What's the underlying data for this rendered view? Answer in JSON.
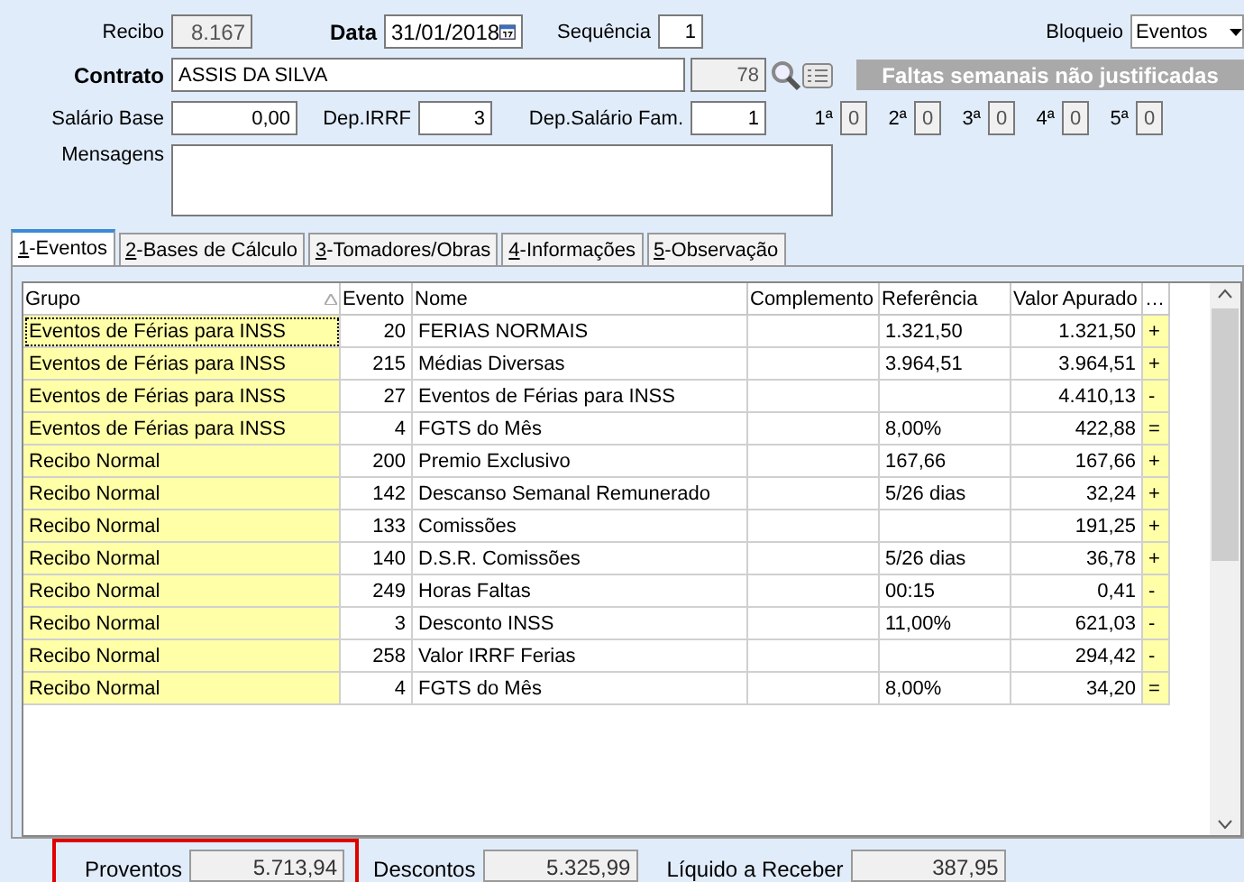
{
  "header": {
    "recibo": {
      "label": "Recibo",
      "value": "8.167"
    },
    "data": {
      "label": "Data",
      "value": "31/01/2018"
    },
    "sequencia": {
      "label": "Sequência",
      "value": "1"
    },
    "bloqueio": {
      "label": "Bloqueio",
      "value": "Eventos"
    },
    "contrato": {
      "label": "Contrato",
      "name": "ASSIS DA SILVA",
      "code": "78"
    },
    "salario_base": {
      "label": "Salário Base",
      "value": "0,00"
    },
    "dep_irrf": {
      "label": "Dep.IRRF",
      "value": "3"
    },
    "dep_salario_fam": {
      "label": "Dep.Salário Fam.",
      "value": "1"
    },
    "faltas": {
      "title": "Faltas semanais não justificadas",
      "weeks": [
        {
          "label": "1ª",
          "value": "0"
        },
        {
          "label": "2ª",
          "value": "0"
        },
        {
          "label": "3ª",
          "value": "0"
        },
        {
          "label": "4ª",
          "value": "0"
        },
        {
          "label": "5ª",
          "value": "0"
        }
      ]
    },
    "mensagens": {
      "label": "Mensagens"
    }
  },
  "tabs": [
    {
      "key": "1",
      "label": "-Eventos",
      "selected": true
    },
    {
      "key": "2",
      "label": "-Bases de Cálculo",
      "selected": false
    },
    {
      "key": "3",
      "label": "-Tomadores/Obras",
      "selected": false
    },
    {
      "key": "4",
      "label": "-Informações",
      "selected": false
    },
    {
      "key": "5",
      "label": "-Observação",
      "selected": false
    }
  ],
  "table": {
    "columns": [
      "Grupo",
      "Evento",
      "Nome",
      "Complemento",
      "Referência",
      "Valor Apurado",
      "…"
    ],
    "rows": [
      {
        "grupo": "Eventos de Férias para INSS",
        "evento": "20",
        "nome": "FERIAS NORMAIS",
        "referencia": "1.321,50",
        "valor": "1.321,50",
        "sinal": "+",
        "selected": true
      },
      {
        "grupo": "Eventos de Férias para INSS",
        "evento": "215",
        "nome": "Médias Diversas",
        "referencia": "3.964,51",
        "valor": "3.964,51",
        "sinal": "+",
        "selected": false
      },
      {
        "grupo": "Eventos de Férias para INSS",
        "evento": "27",
        "nome": "Eventos de Férias para INSS",
        "valor": "4.410,13",
        "sinal": "-",
        "selected": false
      },
      {
        "grupo": "Eventos de Férias para INSS",
        "evento": "4",
        "nome": "FGTS do Mês",
        "referencia": "8,00%",
        "valor": "422,88",
        "sinal": "=",
        "selected": false
      },
      {
        "grupo": "Recibo Normal",
        "evento": "200",
        "nome": "Premio Exclusivo",
        "referencia": "167,66",
        "valor": "167,66",
        "sinal": "+",
        "selected": false
      },
      {
        "grupo": "Recibo Normal",
        "evento": "142",
        "nome": "Descanso Semanal Remunerado",
        "referencia": "5/26 dias",
        "valor": "32,24",
        "sinal": "+",
        "selected": false
      },
      {
        "grupo": "Recibo Normal",
        "evento": "133",
        "nome": "Comissões",
        "valor": "191,25",
        "sinal": "+",
        "selected": false
      },
      {
        "grupo": "Recibo Normal",
        "evento": "140",
        "nome": "D.S.R. Comissões",
        "referencia": "5/26 dias",
        "valor": "36,78",
        "sinal": "+",
        "selected": false
      },
      {
        "grupo": "Recibo Normal",
        "evento": "249",
        "nome": "Horas Faltas",
        "referencia": "00:15",
        "valor": "0,41",
        "sinal": "-",
        "selected": false
      },
      {
        "grupo": "Recibo Normal",
        "evento": "3",
        "nome": "Desconto INSS",
        "referencia": "11,00%",
        "valor": "621,03",
        "sinal": "-",
        "selected": false
      },
      {
        "grupo": "Recibo Normal",
        "evento": "258",
        "nome": "Valor IRRF Ferias",
        "valor": "294,42",
        "sinal": "-",
        "selected": false
      },
      {
        "grupo": "Recibo Normal",
        "evento": "4",
        "nome": "FGTS do Mês",
        "referencia": "8,00%",
        "valor": "34,20",
        "sinal": "=",
        "selected": false
      }
    ]
  },
  "totals": [
    {
      "label": "Proventos",
      "value": "5.713,94",
      "highlighted": true
    },
    {
      "label": "Descontos",
      "value": "5.325,99",
      "highlighted": false
    },
    {
      "label": "Líquido a Receber",
      "value": "387,95",
      "highlighted": false
    }
  ]
}
